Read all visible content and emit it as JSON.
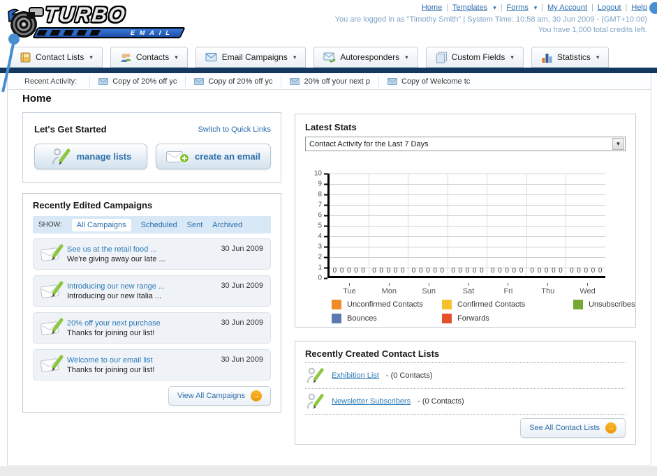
{
  "icons": {
    "caret": "▾",
    "arrow": "→",
    "select_arrow": "▼"
  },
  "header": {
    "logo": {
      "title": "TURBO",
      "subtitle": "EMAIL"
    },
    "nav_links": [
      "Home",
      "Templates",
      "Forms",
      "My Account",
      "Logout",
      "Help"
    ],
    "login_status": "You are logged in as \"Timothy Smith\" | System Time: 10:58 am, 30 Jun 2009 - (GMT+10:00)",
    "credits": "You have 1,000 total credits left."
  },
  "tabs": [
    {
      "label": "Contact Lists"
    },
    {
      "label": "Contacts"
    },
    {
      "label": "Email Campaigns"
    },
    {
      "label": "Autoresponders"
    },
    {
      "label": "Custom Fields"
    },
    {
      "label": "Statistics"
    }
  ],
  "recent_activity": {
    "label": "Recent Activity:",
    "items": [
      "Copy of 20% off yc",
      "Copy of 20% off yc",
      "20% off your next p",
      "Copy of Welcome tc"
    ]
  },
  "page_title": "Home",
  "get_started": {
    "title": "Let's Get Started",
    "switch_link": "Switch to Quick Links",
    "buttons": [
      {
        "label": "manage lists"
      },
      {
        "label": "create an email"
      }
    ]
  },
  "campaigns": {
    "title": "Recently Edited Campaigns",
    "show_label": "SHOW:",
    "filters": [
      "All Campaigns",
      "Scheduled",
      "Sent",
      "Archived"
    ],
    "active_filter": "All Campaigns",
    "items": [
      {
        "title": "See us at the retail food ...",
        "subtitle": "We're giving away our late ...",
        "date": "30 Jun 2009"
      },
      {
        "title": "Introducing our new range ...",
        "subtitle": "Introducing our new Italia ...",
        "date": "30 Jun 2009"
      },
      {
        "title": "20% off your next purchase",
        "subtitle": "Thanks for joining our list!",
        "date": "30 Jun 2009"
      },
      {
        "title": "Welcome to our email list",
        "subtitle": "Thanks for joining our list!",
        "date": "30 Jun 2009"
      }
    ],
    "view_all_label": "View All Campaigns"
  },
  "latest_stats": {
    "title": "Latest Stats",
    "selected_option": "Contact Activity for the Last 7 Days"
  },
  "chart_data": {
    "type": "bar",
    "title": "Contact Activity for the Last 7 Days",
    "categories": [
      "Tue",
      "Mon",
      "Sun",
      "Sat",
      "Fri",
      "Thu",
      "Wed"
    ],
    "series": [
      {
        "name": "Unconfirmed Contacts",
        "color": "#F08B25",
        "values": [
          0,
          0,
          0,
          0,
          0,
          0,
          0
        ]
      },
      {
        "name": "Confirmed Contacts",
        "color": "#F5C22E",
        "values": [
          0,
          0,
          0,
          0,
          0,
          0,
          0
        ]
      },
      {
        "name": "Unsubscribes",
        "color": "#77A932",
        "values": [
          0,
          0,
          0,
          0,
          0,
          0,
          0
        ]
      },
      {
        "name": "Bounces",
        "color": "#5C79B0",
        "values": [
          0,
          0,
          0,
          0,
          0,
          0,
          0
        ]
      },
      {
        "name": "Forwards",
        "color": "#E4502B",
        "values": [
          0,
          0,
          0,
          0,
          0,
          0,
          0
        ]
      }
    ],
    "ylim": [
      0,
      10
    ],
    "ytick_step": 1,
    "grid": true,
    "legend_position": "bottom"
  },
  "contact_lists": {
    "title": "Recently Created Contact Lists",
    "items": [
      {
        "name": "Exhibition List",
        "detail": "- (0 Contacts)"
      },
      {
        "name": "Newsletter Subscribers",
        "detail": "- (0 Contacts)"
      }
    ],
    "see_all_label": "See All Contact Lists"
  }
}
